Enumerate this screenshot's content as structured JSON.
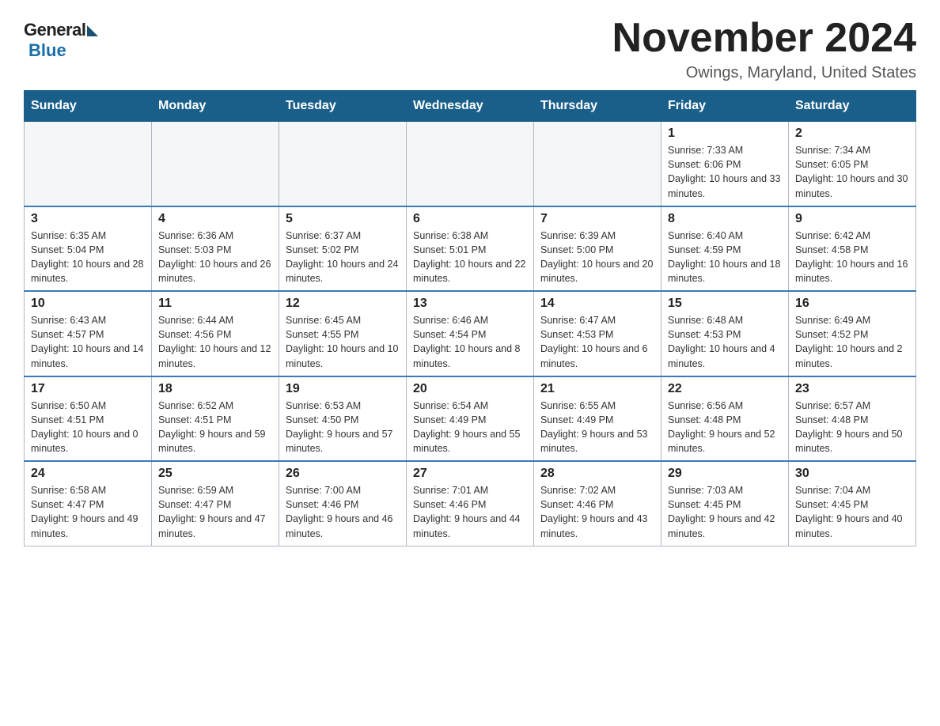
{
  "logo": {
    "general": "General",
    "blue": "Blue"
  },
  "title": "November 2024",
  "location": "Owings, Maryland, United States",
  "weekdays": [
    "Sunday",
    "Monday",
    "Tuesday",
    "Wednesday",
    "Thursday",
    "Friday",
    "Saturday"
  ],
  "weeks": [
    [
      {
        "day": "",
        "info": ""
      },
      {
        "day": "",
        "info": ""
      },
      {
        "day": "",
        "info": ""
      },
      {
        "day": "",
        "info": ""
      },
      {
        "day": "",
        "info": ""
      },
      {
        "day": "1",
        "info": "Sunrise: 7:33 AM\nSunset: 6:06 PM\nDaylight: 10 hours and 33 minutes."
      },
      {
        "day": "2",
        "info": "Sunrise: 7:34 AM\nSunset: 6:05 PM\nDaylight: 10 hours and 30 minutes."
      }
    ],
    [
      {
        "day": "3",
        "info": "Sunrise: 6:35 AM\nSunset: 5:04 PM\nDaylight: 10 hours and 28 minutes."
      },
      {
        "day": "4",
        "info": "Sunrise: 6:36 AM\nSunset: 5:03 PM\nDaylight: 10 hours and 26 minutes."
      },
      {
        "day": "5",
        "info": "Sunrise: 6:37 AM\nSunset: 5:02 PM\nDaylight: 10 hours and 24 minutes."
      },
      {
        "day": "6",
        "info": "Sunrise: 6:38 AM\nSunset: 5:01 PM\nDaylight: 10 hours and 22 minutes."
      },
      {
        "day": "7",
        "info": "Sunrise: 6:39 AM\nSunset: 5:00 PM\nDaylight: 10 hours and 20 minutes."
      },
      {
        "day": "8",
        "info": "Sunrise: 6:40 AM\nSunset: 4:59 PM\nDaylight: 10 hours and 18 minutes."
      },
      {
        "day": "9",
        "info": "Sunrise: 6:42 AM\nSunset: 4:58 PM\nDaylight: 10 hours and 16 minutes."
      }
    ],
    [
      {
        "day": "10",
        "info": "Sunrise: 6:43 AM\nSunset: 4:57 PM\nDaylight: 10 hours and 14 minutes."
      },
      {
        "day": "11",
        "info": "Sunrise: 6:44 AM\nSunset: 4:56 PM\nDaylight: 10 hours and 12 minutes."
      },
      {
        "day": "12",
        "info": "Sunrise: 6:45 AM\nSunset: 4:55 PM\nDaylight: 10 hours and 10 minutes."
      },
      {
        "day": "13",
        "info": "Sunrise: 6:46 AM\nSunset: 4:54 PM\nDaylight: 10 hours and 8 minutes."
      },
      {
        "day": "14",
        "info": "Sunrise: 6:47 AM\nSunset: 4:53 PM\nDaylight: 10 hours and 6 minutes."
      },
      {
        "day": "15",
        "info": "Sunrise: 6:48 AM\nSunset: 4:53 PM\nDaylight: 10 hours and 4 minutes."
      },
      {
        "day": "16",
        "info": "Sunrise: 6:49 AM\nSunset: 4:52 PM\nDaylight: 10 hours and 2 minutes."
      }
    ],
    [
      {
        "day": "17",
        "info": "Sunrise: 6:50 AM\nSunset: 4:51 PM\nDaylight: 10 hours and 0 minutes."
      },
      {
        "day": "18",
        "info": "Sunrise: 6:52 AM\nSunset: 4:51 PM\nDaylight: 9 hours and 59 minutes."
      },
      {
        "day": "19",
        "info": "Sunrise: 6:53 AM\nSunset: 4:50 PM\nDaylight: 9 hours and 57 minutes."
      },
      {
        "day": "20",
        "info": "Sunrise: 6:54 AM\nSunset: 4:49 PM\nDaylight: 9 hours and 55 minutes."
      },
      {
        "day": "21",
        "info": "Sunrise: 6:55 AM\nSunset: 4:49 PM\nDaylight: 9 hours and 53 minutes."
      },
      {
        "day": "22",
        "info": "Sunrise: 6:56 AM\nSunset: 4:48 PM\nDaylight: 9 hours and 52 minutes."
      },
      {
        "day": "23",
        "info": "Sunrise: 6:57 AM\nSunset: 4:48 PM\nDaylight: 9 hours and 50 minutes."
      }
    ],
    [
      {
        "day": "24",
        "info": "Sunrise: 6:58 AM\nSunset: 4:47 PM\nDaylight: 9 hours and 49 minutes."
      },
      {
        "day": "25",
        "info": "Sunrise: 6:59 AM\nSunset: 4:47 PM\nDaylight: 9 hours and 47 minutes."
      },
      {
        "day": "26",
        "info": "Sunrise: 7:00 AM\nSunset: 4:46 PM\nDaylight: 9 hours and 46 minutes."
      },
      {
        "day": "27",
        "info": "Sunrise: 7:01 AM\nSunset: 4:46 PM\nDaylight: 9 hours and 44 minutes."
      },
      {
        "day": "28",
        "info": "Sunrise: 7:02 AM\nSunset: 4:46 PM\nDaylight: 9 hours and 43 minutes."
      },
      {
        "day": "29",
        "info": "Sunrise: 7:03 AM\nSunset: 4:45 PM\nDaylight: 9 hours and 42 minutes."
      },
      {
        "day": "30",
        "info": "Sunrise: 7:04 AM\nSunset: 4:45 PM\nDaylight: 9 hours and 40 minutes."
      }
    ]
  ]
}
